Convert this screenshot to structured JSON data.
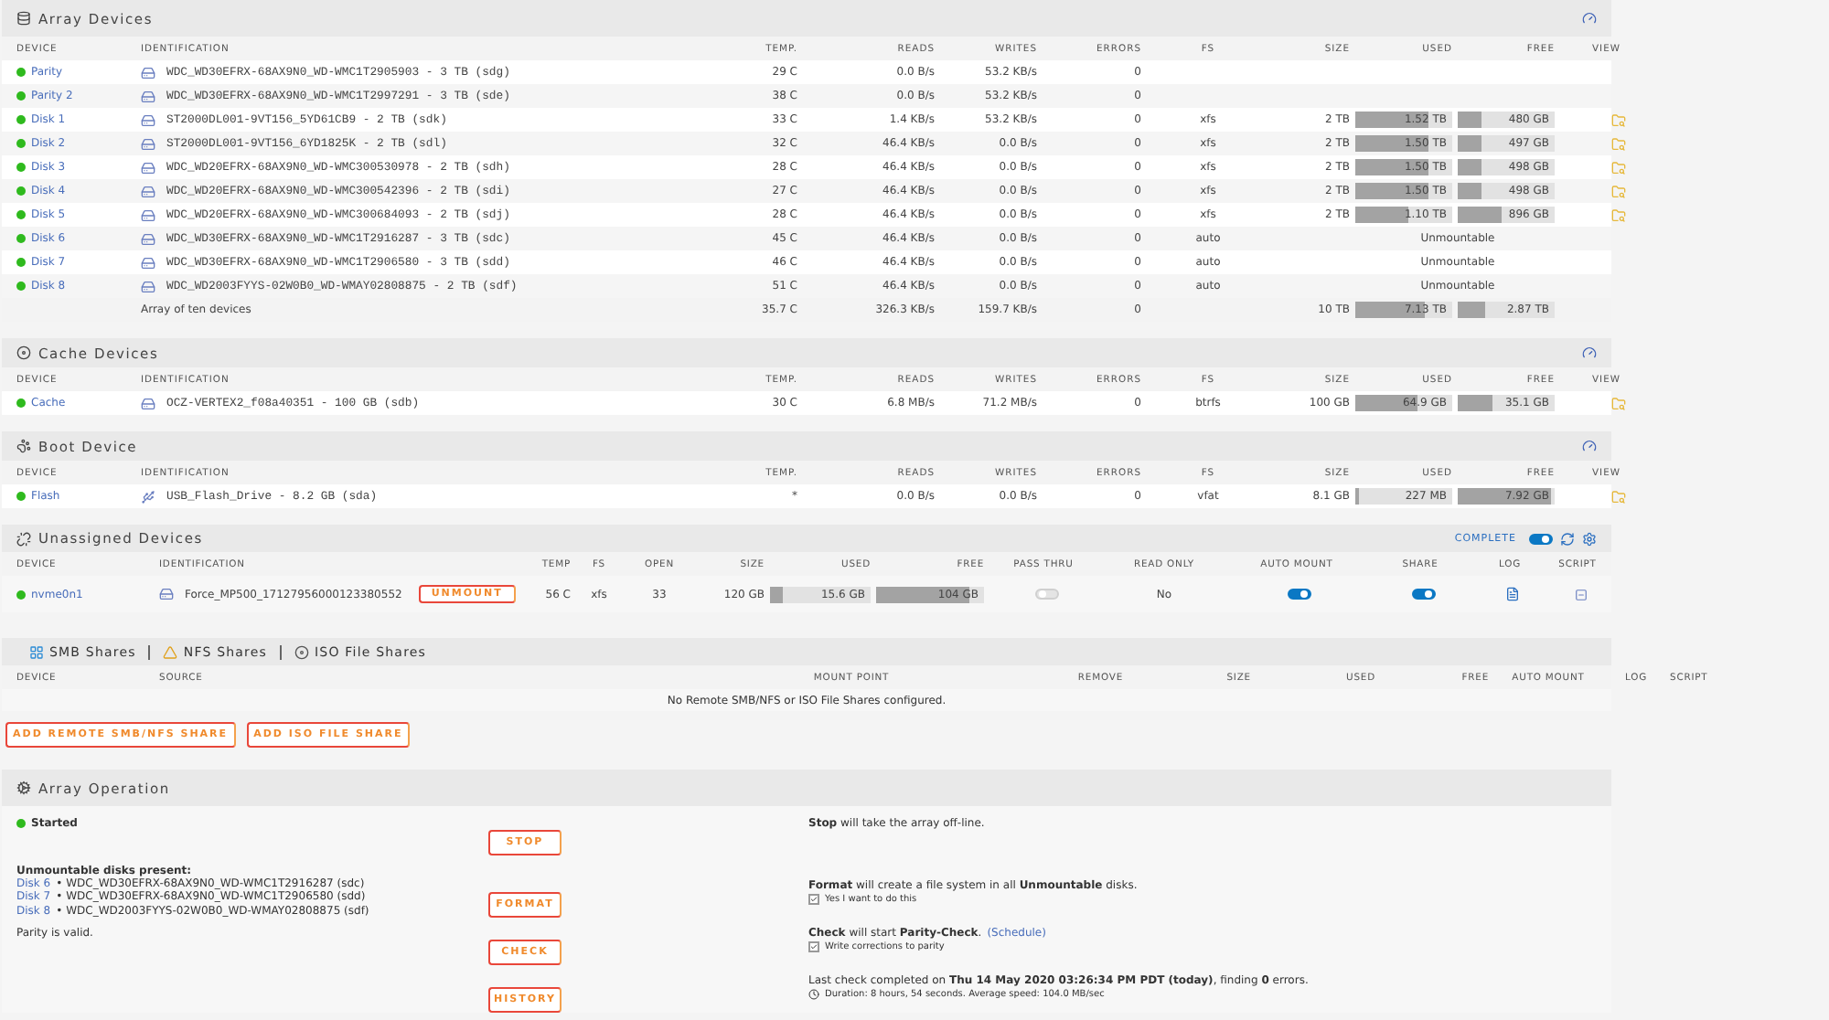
{
  "array_devices": {
    "title": "Array Devices",
    "columns": [
      "DEVICE",
      "IDENTIFICATION",
      "TEMP.",
      "READS",
      "WRITES",
      "ERRORS",
      "FS",
      "SIZE",
      "USED",
      "FREE",
      "VIEW"
    ],
    "rows": [
      {
        "device": "Parity",
        "online": true,
        "identification": "WDC_WD30EFRX-68AX9N0_WD-WMC1T2905903 - 3 TB (sdg)",
        "temp": "29 C",
        "reads": "0.0 B/s",
        "writes": "53.2 KB/s",
        "errors": "0"
      },
      {
        "device": "Parity 2",
        "online": true,
        "identification": "WDC_WD30EFRX-68AX9N0_WD-WMC1T2997291 - 3 TB (sde)",
        "temp": "38 C",
        "reads": "0.0 B/s",
        "writes": "53.2 KB/s",
        "errors": "0"
      },
      {
        "device": "Disk 1",
        "online": true,
        "identification": "ST2000DL001-9VT156_5YD61CB9 - 2 TB (sdk)",
        "temp": "33 C",
        "reads": "1.4 KB/s",
        "writes": "53.2 KB/s",
        "errors": "0",
        "fs": "xfs",
        "size": "2 TB",
        "used": {
          "text": "1.52 TB",
          "level": 0.76
        },
        "free": {
          "text": "480 GB",
          "level": 0.24
        }
      },
      {
        "device": "Disk 2",
        "online": true,
        "identification": "ST2000DL001-9VT156_6YD1825K - 2 TB (sdl)",
        "temp": "32 C",
        "reads": "46.4 KB/s",
        "writes": "0.0 B/s",
        "errors": "0",
        "fs": "xfs",
        "size": "2 TB",
        "used": {
          "text": "1.50 TB",
          "level": 0.75
        },
        "free": {
          "text": "497 GB",
          "level": 0.25
        }
      },
      {
        "device": "Disk 3",
        "online": true,
        "identification": "WDC_WD20EFRX-68AX9N0_WD-WMC300530978 - 2 TB (sdh)",
        "temp": "28 C",
        "reads": "46.4 KB/s",
        "writes": "0.0 B/s",
        "errors": "0",
        "fs": "xfs",
        "size": "2 TB",
        "used": {
          "text": "1.50 TB",
          "level": 0.75
        },
        "free": {
          "text": "498 GB",
          "level": 0.25
        }
      },
      {
        "device": "Disk 4",
        "online": true,
        "identification": "WDC_WD20EFRX-68AX9N0_WD-WMC300542396 - 2 TB (sdi)",
        "temp": "27 C",
        "reads": "46.4 KB/s",
        "writes": "0.0 B/s",
        "errors": "0",
        "fs": "xfs",
        "size": "2 TB",
        "used": {
          "text": "1.50 TB",
          "level": 0.75
        },
        "free": {
          "text": "498 GB",
          "level": 0.25
        }
      },
      {
        "device": "Disk 5",
        "online": true,
        "identification": "WDC_WD20EFRX-68AX9N0_WD-WMC300684093 - 2 TB (sdj)",
        "temp": "28 C",
        "reads": "46.4 KB/s",
        "writes": "0.0 B/s",
        "errors": "0",
        "fs": "xfs",
        "size": "2 TB",
        "used": {
          "text": "1.10 TB",
          "level": 0.55
        },
        "free": {
          "text": "896 GB",
          "level": 0.45
        }
      },
      {
        "device": "Disk 6",
        "online": true,
        "identification": "WDC_WD30EFRX-68AX9N0_WD-WMC1T2916287 - 3 TB (sdc)",
        "temp": "45 C",
        "reads": "46.4 KB/s",
        "writes": "0.0 B/s",
        "errors": "0",
        "fs": "auto",
        "note": "Unmountable"
      },
      {
        "device": "Disk 7",
        "online": true,
        "identification": "WDC_WD30EFRX-68AX9N0_WD-WMC1T2906580 - 3 TB (sdd)",
        "temp": "46 C",
        "reads": "46.4 KB/s",
        "writes": "0.0 B/s",
        "errors": "0",
        "fs": "auto",
        "note": "Unmountable"
      },
      {
        "device": "Disk 8",
        "online": true,
        "identification": "WDC_WD2003FYYS-02W0B0_WD-WMAY02808875 - 2 TB (sdf)",
        "temp": "51 C",
        "reads": "46.4 KB/s",
        "writes": "0.0 B/s",
        "errors": "0",
        "fs": "auto",
        "note": "Unmountable"
      }
    ],
    "total": {
      "label": "Array of ten devices",
      "temp": "35.7 C",
      "reads": "326.3 KB/s",
      "writes": "159.7 KB/s",
      "errors": "0",
      "size": "10 TB",
      "used": {
        "text": "7.13 TB",
        "level": 0.71
      },
      "free": {
        "text": "2.87 TB",
        "level": 0.29
      }
    }
  },
  "cache_devices": {
    "title": "Cache Devices",
    "columns": [
      "DEVICE",
      "IDENTIFICATION",
      "TEMP.",
      "READS",
      "WRITES",
      "ERRORS",
      "FS",
      "SIZE",
      "USED",
      "FREE",
      "VIEW"
    ],
    "rows": [
      {
        "device": "Cache",
        "online": true,
        "identification": "OCZ-VERTEX2_f08a40351 - 100 GB (sdb)",
        "temp": "30 C",
        "reads": "6.8 MB/s",
        "writes": "71.2 MB/s",
        "errors": "0",
        "fs": "btrfs",
        "size": "100 GB",
        "used": {
          "text": "64.9 GB",
          "level": 0.65
        },
        "free": {
          "text": "35.1 GB",
          "level": 0.35
        }
      }
    ]
  },
  "boot_device": {
    "title": "Boot Device",
    "columns": [
      "DEVICE",
      "IDENTIFICATION",
      "TEMP.",
      "READS",
      "WRITES",
      "ERRORS",
      "FS",
      "SIZE",
      "USED",
      "FREE",
      "VIEW"
    ],
    "rows": [
      {
        "device": "Flash",
        "online": true,
        "identification": "USB_Flash_Drive - 8.2 GB (sda)",
        "temp": "*",
        "reads": "0.0 B/s",
        "writes": "0.0 B/s",
        "errors": "0",
        "fs": "vfat",
        "size": "8.1 GB",
        "used": {
          "text": "227 MB",
          "level": 0.03
        },
        "free": {
          "text": "7.92 GB",
          "level": 0.97
        }
      }
    ]
  },
  "unassigned_devices": {
    "title": "Unassigned Devices",
    "complete_label": "COMPLETE",
    "complete_on": true,
    "columns": [
      "DEVICE",
      "IDENTIFICATION",
      "TEMP",
      "FS",
      "OPEN",
      "SIZE",
      "USED",
      "FREE",
      "PASS THRU",
      "READ ONLY",
      "AUTO MOUNT",
      "SHARE",
      "LOG",
      "SCRIPT"
    ],
    "rows": [
      {
        "device": "nvme0n1",
        "online": true,
        "identification": "Force_MP500_17127956000123380552",
        "action": "UNMOUNT",
        "temp": "56 C",
        "fs": "xfs",
        "open": "33",
        "size": "120 GB",
        "used": {
          "text": "15.6 GB",
          "level": 0.13
        },
        "free": {
          "text": "104 GB",
          "level": 0.87
        },
        "pass_thru": false,
        "read_only": "No",
        "auto_mount": true,
        "share": true
      }
    ]
  },
  "shares": {
    "tabs": [
      "SMB Shares",
      "NFS Shares",
      "ISO File Shares"
    ],
    "columns": [
      "DEVICE",
      "SOURCE",
      "MOUNT POINT",
      "REMOVE",
      "SIZE",
      "USED",
      "FREE",
      "AUTO MOUNT",
      "LOG",
      "SCRIPT"
    ],
    "empty_message": "No Remote SMB/NFS or ISO File Shares configured.",
    "buttons": [
      "ADD REMOTE SMB/NFS SHARE",
      "ADD ISO FILE SHARE"
    ]
  },
  "array_operation": {
    "title": "Array Operation",
    "status": {
      "text": "Started",
      "running": true
    },
    "stop": {
      "button": "STOP",
      "description": "**Stop** will take the array off-line."
    },
    "unmountable": {
      "heading": "Unmountable disks present:",
      "disks": [
        {
          "disk": "Disk 6",
          "text": "• WDC_WD30EFRX-68AX9N0_WD-WMC1T2916287 (sdc)"
        },
        {
          "disk": "Disk 7",
          "text": "• WDC_WD30EFRX-68AX9N0_WD-WMC1T2906580 (sdd)"
        },
        {
          "disk": "Disk 8",
          "text": "• WDC_WD2003FYYS-02W0B0_WD-WMAY02808875 (sdf)"
        }
      ]
    },
    "format": {
      "button": "FORMAT",
      "description": "**Format** will create a file system in all **Unmountable** disks.",
      "confirm": {
        "label": "Yes I want to do this",
        "checked": true
      }
    },
    "parity": {
      "text": "Parity is valid.",
      "button": "CHECK",
      "description": "**Check** will start **Parity-Check**.",
      "link": "(Schedule)",
      "option": {
        "label": "Write corrections to parity",
        "checked": true
      }
    },
    "history": {
      "button": "HISTORY",
      "description": "Last check completed on **Thu 14 May 2020 03:26:34 PM PDT (today)**, finding **0** errors.",
      "detail": "Duration: 8 hours, 54 seconds. Average speed: 104.0 MB/sec"
    }
  }
}
